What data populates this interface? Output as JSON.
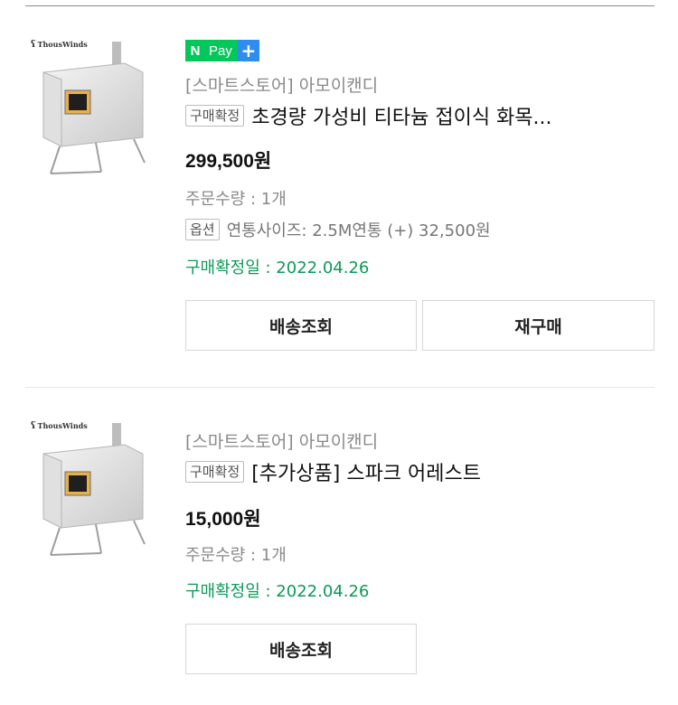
{
  "orders": [
    {
      "brand": "ThousWinds",
      "npay": {
        "n": "N",
        "pay": "Pay",
        "plus": "+"
      },
      "store": "[스마트스토어] 아모이캔디",
      "status_tag": "구매확정",
      "title": "초경량 가성비 티타늄 접이식 화목...",
      "price": "299,500원",
      "quantity": "주문수량 : 1개",
      "option_tag": "옵션",
      "option_text": "연통사이즈: 2.5M연통 (+) 32,500원",
      "confirm_date": "구매확정일 : 2022.04.26",
      "buttons": [
        "배송조회",
        "재구매"
      ]
    },
    {
      "brand": "ThousWinds",
      "store": "[스마트스토어] 아모이캔디",
      "status_tag": "구매확정",
      "title": "[추가상품] 스파크 어레스트",
      "price": "15,000원",
      "quantity": "주문수량 : 1개",
      "confirm_date": "구매확정일 : 2022.04.26",
      "buttons": [
        "배송조회"
      ]
    }
  ],
  "colors": {
    "npay_green": "#03c75a",
    "npay_blue": "#2f8cf0",
    "confirm_green": "#0b9b57"
  },
  "icons": [
    "brand-logo-icon",
    "npay-plus-icon"
  ]
}
